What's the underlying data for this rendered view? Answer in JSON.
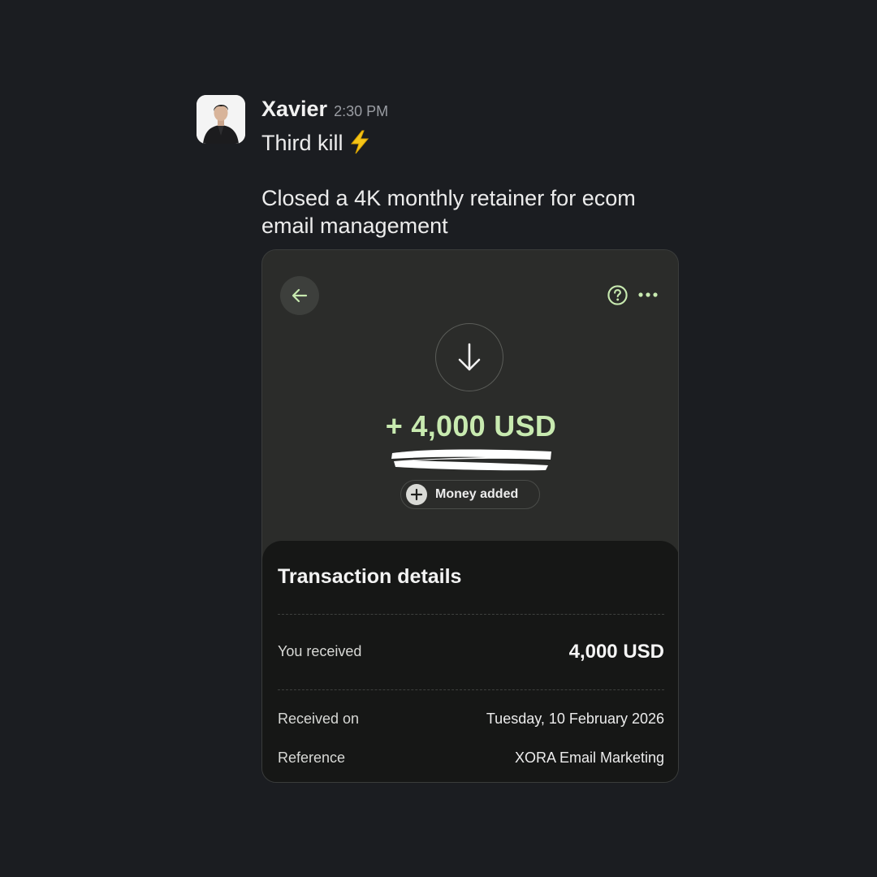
{
  "message": {
    "sender": "Xavier",
    "timestamp": "2:30 PM",
    "line1": "Third kill",
    "line1_emoji": "lightning-bolt",
    "line2": "Closed a 4K monthly retainer for ecom",
    "line3": "email management"
  },
  "card": {
    "amount": "+ 4,000 USD",
    "status": "Money added",
    "details_title": "Transaction details",
    "rows": [
      {
        "label": "You received",
        "value": "4,000 USD"
      },
      {
        "label": "Received on",
        "value": "Tuesday, 10 February 2026"
      },
      {
        "label": "Reference",
        "value": "XORA Email Marketing"
      }
    ],
    "icons": {
      "back": "arrow-left-icon",
      "help": "question-circle-icon",
      "more": "more-dots-icon",
      "direction": "arrow-down-icon",
      "status": "plus-icon"
    }
  },
  "colors": {
    "background": "#1b1d21",
    "card": "#2b2c2a",
    "accent_green": "#c8eab0",
    "details_panel": "#161716"
  }
}
